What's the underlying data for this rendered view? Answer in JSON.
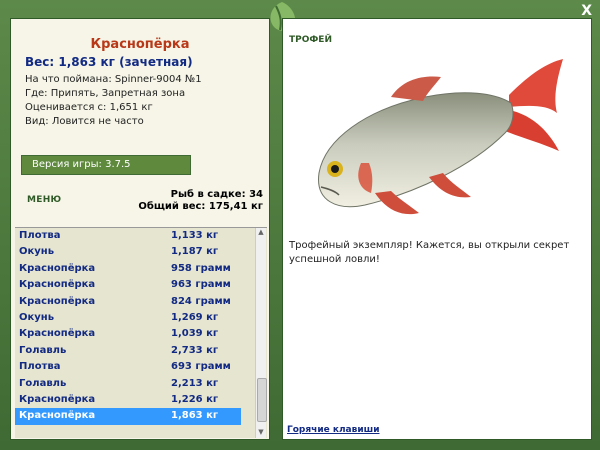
{
  "window": {
    "close_label": "X"
  },
  "fish": {
    "title": "Краснопёрка",
    "weight": "Вес: 1,863 кг (зачетная)",
    "info": [
      "На что поймана: Spinner-9004 №1",
      "Где: Припять, Запретная зона",
      "Оценивается с: 1,651 кг",
      "Вид: Ловится не часто"
    ]
  },
  "version": "Версия игры: 3.7.5",
  "menu_label": "МЕНЮ",
  "stats": {
    "caught": "Рыб в садке: 34",
    "total": "Общий вес: 175,41 кг"
  },
  "catch_list": [
    {
      "name": "Плотва",
      "weight": "1,133 кг"
    },
    {
      "name": "Окунь",
      "weight": "1,187 кг"
    },
    {
      "name": "Краснопёрка",
      "weight": "958 грамм"
    },
    {
      "name": "Краснопёрка",
      "weight": "963 грамм"
    },
    {
      "name": "Краснопёрка",
      "weight": "824 грамм"
    },
    {
      "name": "Окунь",
      "weight": "1,269 кг"
    },
    {
      "name": "Краснопёрка",
      "weight": "1,039 кг"
    },
    {
      "name": "Голавль",
      "weight": "2,733 кг"
    },
    {
      "name": "Плотва",
      "weight": "693 грамм"
    },
    {
      "name": "Голавль",
      "weight": "2,213 кг"
    },
    {
      "name": "Краснопёрка",
      "weight": "1,226 кг"
    },
    {
      "name": "Краснопёрка",
      "weight": "1,863 кг",
      "selected": true
    }
  ],
  "trophy_label": "ТРОФЕЙ",
  "trophy_text": "Трофейный экземпляр! Кажется, вы открыли секрет успешной ловли!",
  "hotkeys_label": "Горячие клавиши",
  "colors": {
    "accent": "#3399ff",
    "frame": "#4f7a3f",
    "title_red": "#b83818",
    "navy": "#122a83"
  }
}
